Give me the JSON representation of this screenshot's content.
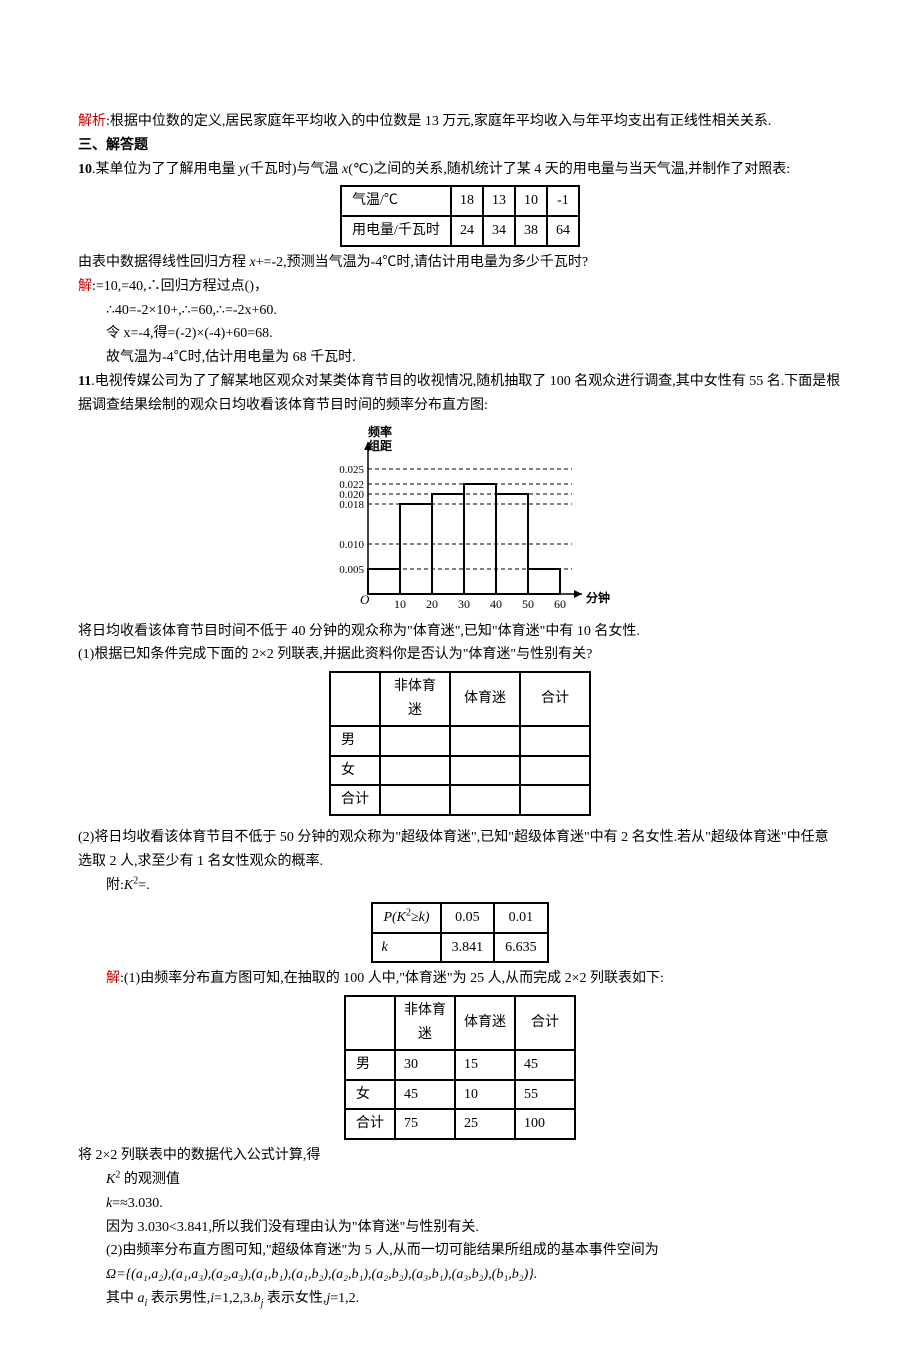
{
  "pre": {
    "analysis_label": "解析",
    "analysis_text": ":根据中位数的定义,居民家庭年平均收入的中位数是 13 万元,家庭年平均收入与年平均支出有正线性相关关系."
  },
  "section3_title": "三、解答题",
  "q10": {
    "num": "10",
    "stem1": ".某单位为了了解用电量 ",
    "var_y": "y",
    "stem2": "(千瓦时)与气温 ",
    "var_x": "x",
    "stem3": "(℃)之间的关系,随机统计了某 4 天的用电量与当天气温,并制作了对照表:",
    "table": {
      "row1_label": "气温/℃",
      "row1": [
        "18",
        "13",
        "10",
        "-1"
      ],
      "row2_label": "用电量/千瓦时",
      "row2": [
        "24",
        "34",
        "38",
        "64"
      ]
    },
    "stem4_a": "由表中数据得线性回归方程 ",
    "stem4_b": "x",
    "stem4_c": "+=-2,预测当气温为-4℃时,请估计用电量为多少千瓦时?",
    "ans_label": "解",
    "ans1": ":=10,=40,∴回归方程过点()，",
    "ans2": "∴40=-2×10+,∴=60,∴=-2x+60.",
    "ans3": "令 x=-4,得=(-2)×(-4)+60=68.",
    "ans4": "故气温为-4℃时,估计用电量为 68 千瓦时."
  },
  "q11": {
    "num": "11",
    "stem1": ".电视传媒公司为了了解某地区观众对某类体育节目的收视情况,随机抽取了 100 名观众进行调查,其中女性有 55 名.下面是根据调查结果绘制的观众日均收看该体育节目时间的频率分布直方图:",
    "stem2": "将日均收看该体育节目时间不低于 40 分钟的观众称为\"体育迷\",已知\"体育迷\"中有 10 名女性.",
    "part1": "(1)根据已知条件完成下面的 2×2 列联表,并据此资料你是否认为\"体育迷\"与性别有关?",
    "contingency_empty": {
      "c1": "非体育迷",
      "c2": "体育迷",
      "c3": "合计",
      "r1": "男",
      "r2": "女",
      "r3": "合计"
    },
    "part2": "(2)将日均收看该体育节目不低于 50 分钟的观众称为\"超级体育迷\",已知\"超级体育迷\"中有 2 名女性.若从\"超级体育迷\"中任意选取 2 人,求至少有 1 名女性观众的概率.",
    "append_a": "附:",
    "append_b": "K",
    "append_c": "2",
    "append_d": "=.",
    "pval_table": {
      "r1c1a": "P(K",
      "r1c1b": "2",
      "r1c1c": "≥k)",
      "r1c2": "0.05",
      "r1c3": "0.01",
      "r2c1": "k",
      "r2c2": "3.841",
      "r2c3": "6.635"
    },
    "ans_label": "解",
    "ans1": ":(1)由频率分布直方图可知,在抽取的 100 人中,\"体育迷\"为 25 人,从而完成 2×2 列联表如下:",
    "contingency_filled": {
      "c1": "非体育迷",
      "c2": "体育迷",
      "c3": "合计",
      "r1": "男",
      "r1v": [
        "30",
        "15",
        "45"
      ],
      "r2": "女",
      "r2v": [
        "45",
        "10",
        "55"
      ],
      "r3": "合计",
      "r3v": [
        "75",
        "25",
        "100"
      ]
    },
    "ans2": "将 2×2 列联表中的数据代入公式计算,得",
    "ans3a": "K",
    "ans3b": "2",
    "ans3c": " 的观测值",
    "ans4": "k=≈3.030.",
    "ans5": "因为 3.030<3.841,所以我们没有理由认为\"体育迷\"与性别有关.",
    "ans6": "(2)由频率分布直方图可知,\"超级体育迷\"为 5 人,从而一切可能结果所组成的基本事件空间为",
    "ans7a": "Ω={(",
    "ans7_pairs": "a₁,a₂),(a₁,a₃),(a₂,a₃),(a₁,b₁),(a₁,b₂),(a₂,b₁),(a₂,b₂),(a₃,b₁),(a₃,b₂),(b₁,b₂)}.",
    "ans8a": "其中 ",
    "ans8b": "a",
    "ans8c": "i",
    "ans8d": " 表示男性,",
    "ans8e": "i",
    "ans8f": "=1,2,3.",
    "ans8g": "b",
    "ans8h": "j",
    "ans8i": " 表示女性,",
    "ans8j": "j",
    "ans8k": "=1,2."
  },
  "chart_data": {
    "type": "bar",
    "title": "",
    "ylabel": "频率/组距",
    "xlabel": "分钟",
    "bin_edges": [
      0,
      10,
      20,
      30,
      40,
      50,
      60
    ],
    "values": [
      0.005,
      0.018,
      0.02,
      0.022,
      0.02,
      0.005
    ],
    "yticks": [
      0.005,
      0.01,
      0.018,
      0.02,
      0.022,
      0.025
    ],
    "xticks": [
      10,
      20,
      30,
      40,
      50,
      60
    ],
    "ylim": [
      0,
      0.027
    ]
  }
}
